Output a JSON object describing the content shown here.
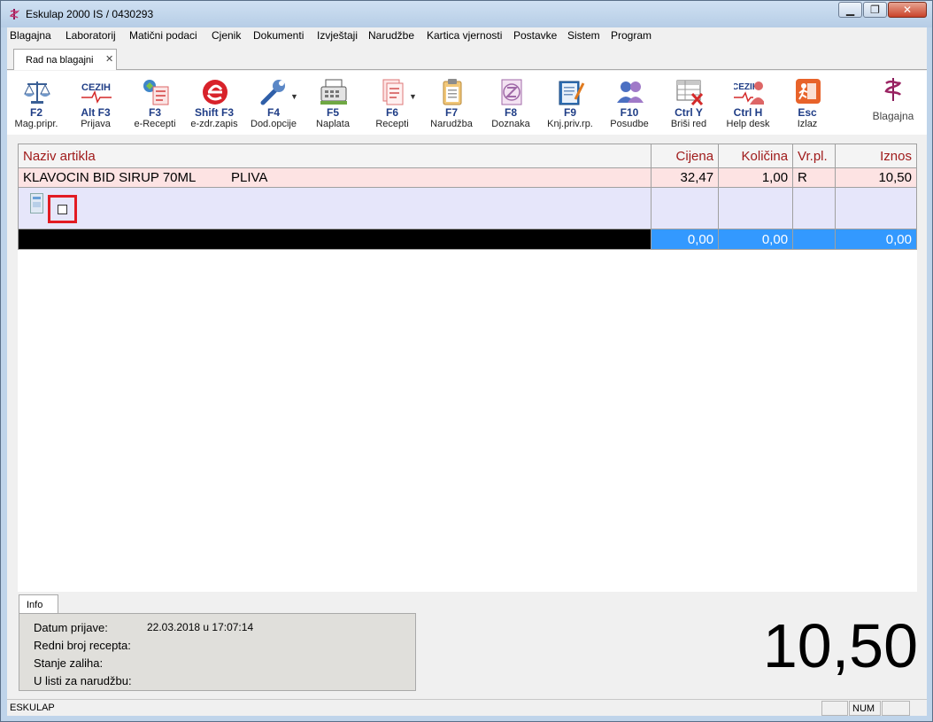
{
  "window": {
    "title": "Eskulap 2000  IS / 0430293",
    "minimize_glyph": "▁",
    "maximize_glyph": "❐",
    "close_glyph": "✕"
  },
  "menu": [
    {
      "label": "Blagajna"
    },
    {
      "label": "Laboratorij"
    },
    {
      "label": "Matični podaci"
    },
    {
      "label": "Cjenik"
    },
    {
      "label": "Dokumenti"
    },
    {
      "label": "Izvještaji"
    },
    {
      "label": "Narudžbe"
    },
    {
      "label": "Kartica vjernosti"
    },
    {
      "label": "Postavke"
    },
    {
      "label": "Sistem"
    },
    {
      "label": "Program"
    }
  ],
  "tab": {
    "label": "Rad na blagajni",
    "close": "✕"
  },
  "toolbar": [
    {
      "key": "F2",
      "label": "Mag.pripr.",
      "icon": "scales-icon"
    },
    {
      "key": "Alt F3",
      "label": "Prijava",
      "icon": "cezih-icon"
    },
    {
      "key": "F3",
      "label": "e-Recepti",
      "icon": "e-prescription-icon"
    },
    {
      "key": "Shift F3",
      "label": "e-zdr.zapis",
      "icon": "e-health-record-icon"
    },
    {
      "key": "F4",
      "label": "Dod.opcije",
      "icon": "wrench-icon"
    },
    {
      "key": "F5",
      "label": "Naplata",
      "icon": "cash-register-icon"
    },
    {
      "key": "F6",
      "label": "Recepti",
      "icon": "prescriptions-icon"
    },
    {
      "key": "F7",
      "label": "Narudžba",
      "icon": "clipboard-icon"
    },
    {
      "key": "F8",
      "label": "Doznaka",
      "icon": "doznaka-icon"
    },
    {
      "key": "F9",
      "label": "Knj.priv.rp.",
      "icon": "book-icon"
    },
    {
      "key": "F10",
      "label": "Posudbe",
      "icon": "users-icon"
    },
    {
      "key": "Ctrl Y",
      "label": "Briši red",
      "icon": "delete-row-icon"
    },
    {
      "key": "Ctrl H",
      "label": "Help desk",
      "icon": "helpdesk-icon"
    },
    {
      "key": "Esc",
      "label": "Izlaz",
      "icon": "exit-icon"
    }
  ],
  "toolbar_extra": {
    "label": "Blagajna",
    "icon": "pharmacy-icon",
    "cezih_text": "CEZIH"
  },
  "grid": {
    "headers": [
      "Naziv artikla",
      "Cijena",
      "Količina",
      "Vr.pl.",
      "Iznos"
    ],
    "item": {
      "name": "KLAVOCIN BID SIRUP  70ML",
      "manufacturer": "PLIVA",
      "price": "32,47",
      "qty": "1,00",
      "pay_type": "R",
      "amount": "10,50"
    },
    "totals": {
      "price": "0,00",
      "qty": "0,00",
      "amount": "0,00"
    }
  },
  "info": {
    "tab_label": "Info",
    "rows": [
      {
        "label": "Datum prijave:",
        "value": "22.03.2018 u 17:07:14"
      },
      {
        "label": "Redni broj recepta:",
        "value": ""
      },
      {
        "label": "Stanje zaliha:",
        "value": ""
      },
      {
        "label": "U listi za narudžbu:",
        "value": ""
      }
    ]
  },
  "total_display": "10,50",
  "status": {
    "left": "ESKULAP",
    "num": "NUM"
  },
  "colors": {
    "header_text": "#a01b1b",
    "item_row": "#fde3e3",
    "total_blue": "#3399ff",
    "highlight": "#e21b23"
  }
}
